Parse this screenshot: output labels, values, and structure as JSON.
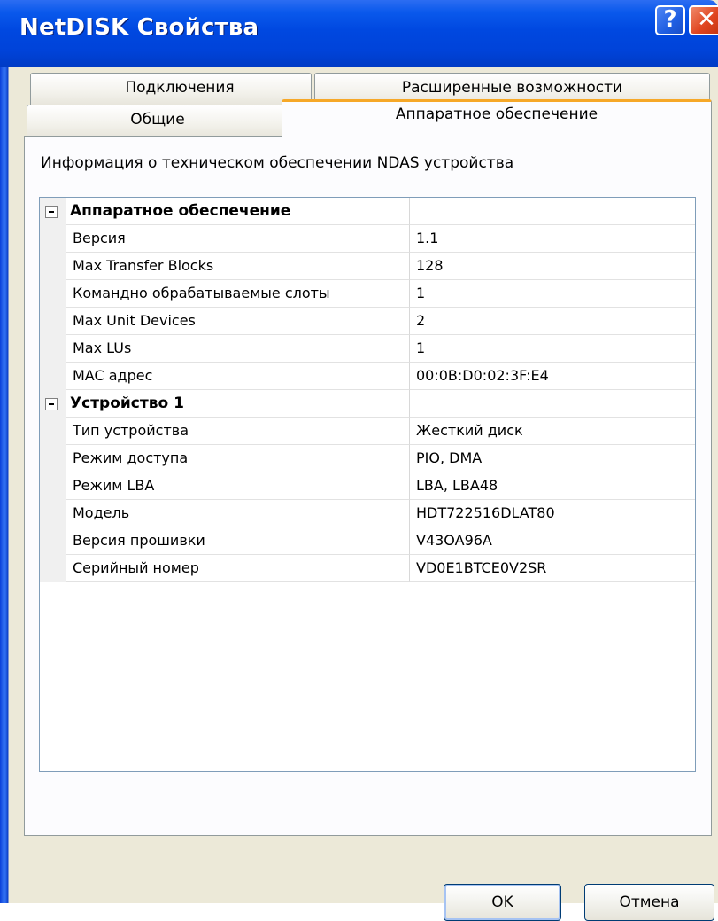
{
  "window": {
    "title": "NetDISK Свойства",
    "help_label": "?",
    "close_label": "✕"
  },
  "tabs": {
    "connections": "Подключения",
    "advanced": "Расширенные возможности",
    "general": "Общие",
    "hardware": "Аппаратное обеспечение"
  },
  "content": {
    "info_label": "Информация о техническом обеспечении NDAS устройства"
  },
  "grid": {
    "hardware_section": {
      "title": "Аппаратное обеспечение",
      "rows": [
        {
          "name": "Версия",
          "value": "1.1"
        },
        {
          "name": "Max Transfer Blocks",
          "value": "128"
        },
        {
          "name": "Командно обрабатываемые слоты",
          "value": "1"
        },
        {
          "name": "Max Unit Devices",
          "value": "2"
        },
        {
          "name": "Max LUs",
          "value": "1"
        },
        {
          "name": "MAC адрес",
          "value": "00:0B:D0:02:3F:E4"
        }
      ]
    },
    "device_section": {
      "title": "Устройство 1",
      "rows": [
        {
          "name": "Тип устройства",
          "value": "Жесткий диск"
        },
        {
          "name": "Режим доступа",
          "value": "PIO, DMA"
        },
        {
          "name": "Режим LBA",
          "value": "LBA, LBA48"
        },
        {
          "name": "Модель",
          "value": "HDT722516DLAT80"
        },
        {
          "name": "Версия прошивки",
          "value": "V43OA96A"
        },
        {
          "name": "Серийный номер",
          "value": "VD0E1BTCE0V2SR"
        }
      ]
    }
  },
  "buttons": {
    "ok": "OK",
    "cancel": "Отмена"
  }
}
